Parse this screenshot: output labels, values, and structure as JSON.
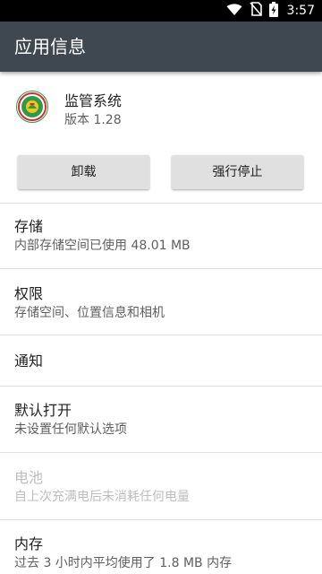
{
  "status_bar": {
    "time": "3:57",
    "icons": [
      "wifi-icon",
      "no-sim-icon",
      "battery-charging-icon"
    ]
  },
  "app_bar": {
    "title": "应用信息"
  },
  "app": {
    "name": "监管系统",
    "version": "版本 1.28",
    "icon": "app-logo-icon"
  },
  "buttons": {
    "uninstall": "卸载",
    "force_stop": "强行停止"
  },
  "items": [
    {
      "title": "存储",
      "summary": "内部存储空间已使用 48.01 MB",
      "enabled": true
    },
    {
      "title": "权限",
      "summary": "存储空间、位置信息和相机",
      "enabled": true
    },
    {
      "title": "通知",
      "summary": "",
      "enabled": true
    },
    {
      "title": "默认打开",
      "summary": "未设置任何默认选项",
      "enabled": true
    },
    {
      "title": "电池",
      "summary": "自上次充满电后未消耗任何电量",
      "enabled": false
    },
    {
      "title": "内存",
      "summary": "过去 3 小时内平均使用了 1.8 MB 内存",
      "enabled": true
    }
  ],
  "colors": {
    "app_bar": "#3f4850",
    "status_bar": "#000000",
    "button": "#e0e0e0",
    "disabled_text": "#bdbdbd"
  }
}
